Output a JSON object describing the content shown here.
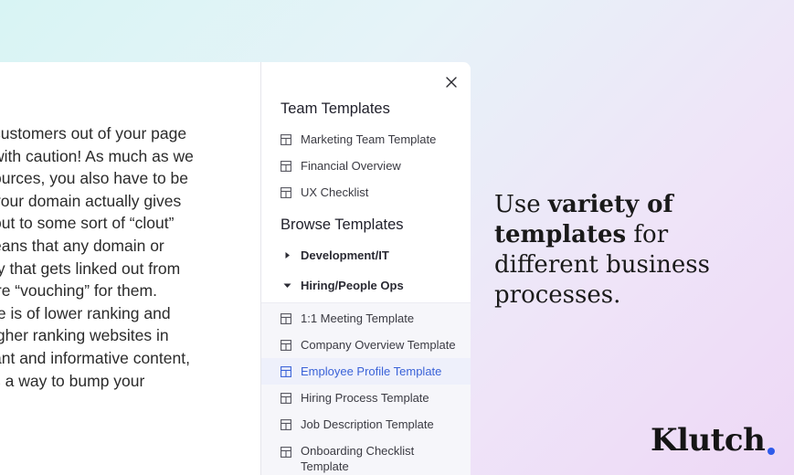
{
  "article": {
    "lines": [
      "customers out of your page",
      " with caution! As much as we",
      "ources, you also have to be",
      " your domain actually gives",
      "out to some sort of “clout”",
      "eans that any domain or",
      "ty that gets linked out from",
      "’re “vouching” for them.",
      "te is of lower ranking and",
      "igher ranking websites in",
      "ant and informative content,",
      "s a way to bump your"
    ]
  },
  "sidebar": {
    "team_title": "Team Templates",
    "team_items": [
      "Marketing Team Template",
      "Financial Overview",
      "UX Checklist"
    ],
    "browse_title": "Browse Templates",
    "groups": [
      {
        "label": "Development/IT",
        "expanded": false
      },
      {
        "label": "Hiring/People Ops",
        "expanded": true
      }
    ],
    "hiring_items": [
      "1:1 Meeting Template",
      "Company Overview Template",
      "Employee Profile Template",
      "Hiring Process Template",
      "Job Description Template",
      "Onboarding Checklist Template"
    ],
    "active_item": "Employee Profile Template"
  },
  "tagline": {
    "part1": "Use ",
    "bold1": "variety of templates",
    "part2": " for different business processes."
  },
  "brand": {
    "name": "Klutch",
    "dot_color": "#2f5bea"
  },
  "colors": {
    "accent": "#3b63d8",
    "active_bg": "#eef0fb"
  },
  "icons": {
    "close": "close-icon",
    "template": "template-icon",
    "caret_right": "caret-right-icon",
    "caret_down": "caret-down-icon"
  }
}
